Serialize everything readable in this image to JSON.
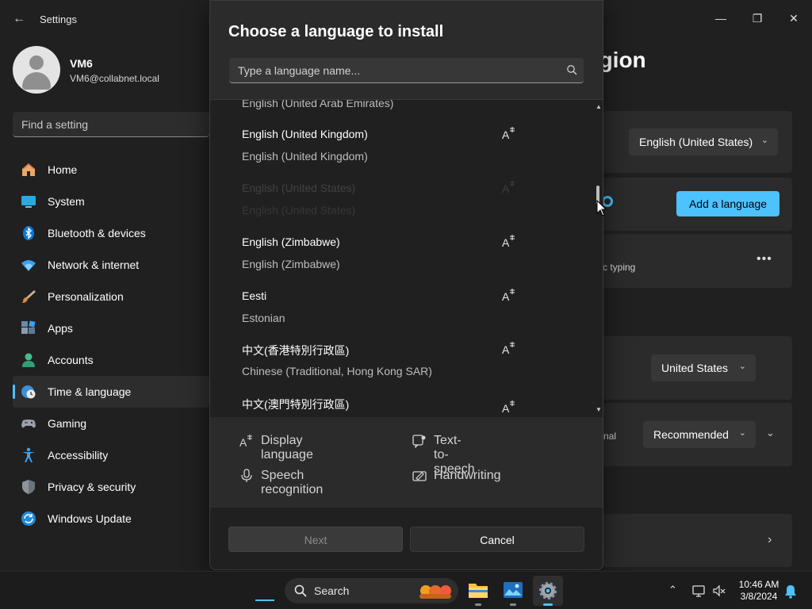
{
  "app": {
    "title": "Settings"
  },
  "profile": {
    "name": "VM6",
    "email": "VM6@collabnet.local"
  },
  "search": {
    "placeholder": "Find a setting"
  },
  "sidebar": {
    "items": [
      {
        "label": "Home"
      },
      {
        "label": "System"
      },
      {
        "label": "Bluetooth & devices"
      },
      {
        "label": "Network & internet"
      },
      {
        "label": "Personalization"
      },
      {
        "label": "Apps"
      },
      {
        "label": "Accounts"
      },
      {
        "label": "Time & language"
      },
      {
        "label": "Gaming"
      },
      {
        "label": "Accessibility"
      },
      {
        "label": "Privacy & security"
      },
      {
        "label": "Windows Update"
      }
    ],
    "active_index": 7
  },
  "page": {
    "title_partial": "egion",
    "windows_display_language": "English (United States)",
    "add_language_label": "Add a language",
    "typing_partial": "c typing",
    "country": "United States",
    "regional_format_partial": "nal",
    "regional_format": "Recommended"
  },
  "dialog": {
    "title": "Choose a language to install",
    "search_placeholder": "Type a language name...",
    "languages": [
      {
        "native": "English (United Arab Emirates)",
        "english": "",
        "state": "clipped"
      },
      {
        "native": "English (United Kingdom)",
        "english": "English (United Kingdom)",
        "state": "available"
      },
      {
        "native": "English (United States)",
        "english": "English (United States)",
        "state": "installed"
      },
      {
        "native": "English (Zimbabwe)",
        "english": "English (Zimbabwe)",
        "state": "available"
      },
      {
        "native": "Eesti",
        "english": "Estonian",
        "state": "available"
      },
      {
        "native": "中文(香港特別行政區)",
        "english": "Chinese (Traditional, Hong Kong SAR)",
        "state": "available"
      },
      {
        "native": "中文(澳門特別行政區)",
        "english": "",
        "state": "available"
      }
    ],
    "features": {
      "display_language": "Display language",
      "text_to_speech": "Text-to-speech",
      "speech_recognition": "Speech recognition",
      "handwriting": "Handwriting"
    },
    "buttons": {
      "next": "Next",
      "cancel": "Cancel"
    }
  },
  "taskbar": {
    "search_label": "Search",
    "time": "10:46 AM",
    "date": "3/8/2024"
  },
  "colors": {
    "accent": "#4cc2ff",
    "background": "#202020",
    "card": "#2b2b2b"
  }
}
